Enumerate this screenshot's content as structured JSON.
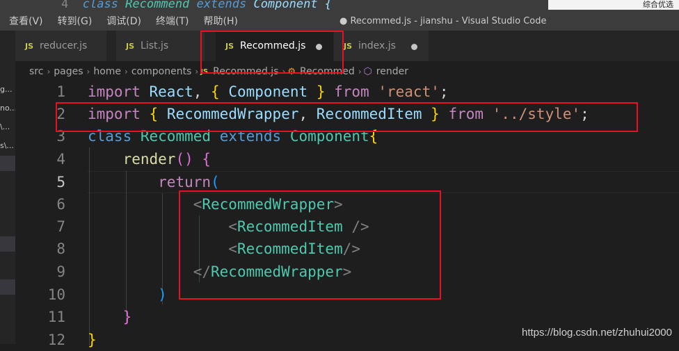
{
  "peek": {
    "line_number": "4",
    "text_prefix": "class",
    "class_name": "Recommend",
    "extends": "extends",
    "parent": "Component {",
    "right_text": "综合优选"
  },
  "menu": [
    "查看(V)",
    "转到(G)",
    "调试(D)",
    "终端(T)",
    "帮助(H)"
  ],
  "window_title": "● Recommed.js - jianshu - Visual Studio Code",
  "left_panel": [
    "g...",
    "no...",
    "\\...",
    "s\\..."
  ],
  "tabs": [
    {
      "icon": "JS",
      "label": "reducer.js"
    },
    {
      "icon": "JS",
      "label": "List.js"
    },
    {
      "icon": "JS",
      "label": "Recommed.js"
    },
    {
      "icon": "JS",
      "label": "index.js"
    }
  ],
  "breadcrumb": {
    "parts": [
      "src",
      "pages",
      "home",
      "components"
    ],
    "file_icon": "JS",
    "file": "Recommed.js",
    "class_name": "Recommed",
    "method": "render"
  },
  "code": {
    "line_numbers": [
      "1",
      "2",
      "3",
      "4",
      "5",
      "6",
      "7",
      "8",
      "9",
      "10",
      "11",
      "12"
    ],
    "l1": {
      "kw": "import",
      "name": "React",
      "comma": ",",
      "lb": "{",
      "imp": "Component",
      "rb": "}",
      "from": "from",
      "str": "'react'",
      "semi": ";"
    },
    "l2": {
      "kw": "import",
      "lb": "{",
      "a": "RecommedWrapper",
      "comma": ",",
      "b": "RecommedItem",
      "rb": "}",
      "from": "from",
      "str": "'../style'",
      "semi": ";"
    },
    "l3": {
      "kw": "class",
      "name": "Recommed",
      "ext": "extends",
      "parent": "Component",
      "lb": "{"
    },
    "l4": {
      "fn": "render",
      "paren": "()",
      "lb": "{"
    },
    "l5": {
      "kw": "return",
      "lp": "("
    },
    "l6": {
      "open": "<",
      "tag": "RecommedWrapper",
      "close": ">"
    },
    "l7": {
      "open": "<",
      "tag": "RecommedItem",
      "close": " />"
    },
    "l8": {
      "open": "<",
      "tag": "RecommedItem",
      "close": "/>"
    },
    "l9": {
      "open": "</",
      "tag": "RecommedWrapper",
      "close": ">"
    },
    "l10": {
      "rp": ")"
    },
    "l11": {
      "rb": "}"
    },
    "l12": {
      "rb": "}"
    }
  },
  "watermark": "https://blog.csdn.net/zhuhui2000",
  "colors": {
    "annotation": "#e81123",
    "js_icon": "#cbcb41",
    "keyword": "#569cd6",
    "jsx_tag": "#4ec9b0"
  }
}
